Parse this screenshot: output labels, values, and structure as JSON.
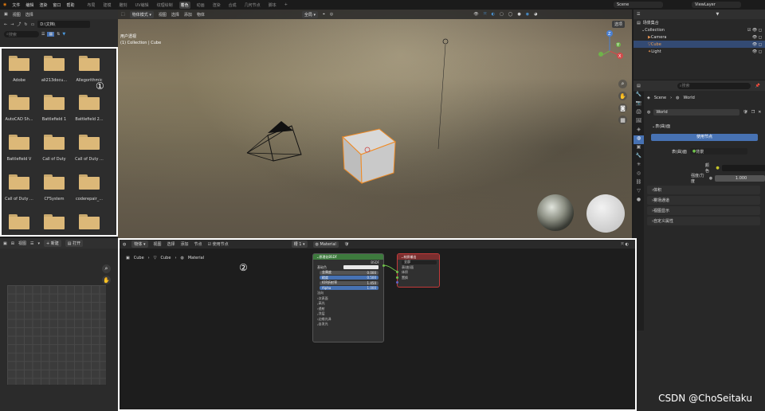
{
  "menu": {
    "items": [
      "文件",
      "编辑",
      "渲染",
      "窗口",
      "帮助"
    ]
  },
  "workspace_tabs": [
    "布局",
    "建模",
    "雕刻",
    "UV编辑",
    "纹理绘制",
    "着色",
    "动画",
    "渲染",
    "合成",
    "几何节点",
    "脚本"
  ],
  "active_tab": "着色",
  "scene": {
    "label": "Scene",
    "view_layer": "ViewLayer"
  },
  "file_browser": {
    "menu": [
      "视图",
      "选择"
    ],
    "path": "D:\\文档\\",
    "search_placeholder": "搜索",
    "folders": [
      "Adobe",
      "ali213docu...",
      "Allegorithmic",
      "AutoCAD Sh...",
      "Battlefield 1",
      "Battlefield 2...",
      "Battlefield V",
      "Call of Duty",
      "Call of Duty ...",
      "Call of Duty ...",
      "CFSystem",
      "coderepair_...",
      "",
      "",
      ""
    ],
    "marker": "①"
  },
  "viewport": {
    "mode": "物体模式",
    "menu": [
      "视图",
      "选择",
      "添加",
      "物体"
    ],
    "transform": "全局",
    "options": "选项",
    "info_line1": "用户透视",
    "info_line2": "(1) Collection | Cube",
    "axis": {
      "z": "Z",
      "y": "Y",
      "x": "X"
    }
  },
  "outliner": {
    "title": "场景集合",
    "rows": [
      {
        "label": "Collection",
        "indent": 1
      },
      {
        "label": "Camera",
        "indent": 2
      },
      {
        "label": "Cube",
        "indent": 2,
        "selected": true
      },
      {
        "label": "Light",
        "indent": 2
      }
    ]
  },
  "properties": {
    "search_placeholder": "搜索",
    "breadcrumb_scene": "Scene",
    "breadcrumb_world": "World",
    "world_name": "World",
    "surface_panel": "表(曲)面",
    "use_nodes": "使用节点",
    "surface_label": "表(曲)面",
    "surface_value": "背景",
    "color_label": "颜色",
    "strength_label": "强度/力度",
    "strength_value": "1.000",
    "sections": [
      "体积",
      "雾场通道",
      "视图显示",
      "自定义属性"
    ]
  },
  "uv_editor": {
    "menu": [
      "视图"
    ],
    "new_label": "新建",
    "open_label": "打开"
  },
  "node_editor": {
    "menu": [
      "物体",
      "视图",
      "选择",
      "添加",
      "节点"
    ],
    "use_nodes": "使用节点",
    "slot": "槽 1",
    "material": "Material",
    "breadcrumb": [
      "Cube",
      "Cube",
      "Material"
    ],
    "marker": "②",
    "bsdf_node": {
      "title": "原理化BSDF",
      "output": "BSDF",
      "rows": [
        "基础色",
        "金属度",
        "糙度",
        "IOR折射率",
        "Alpha"
      ],
      "values": [
        "",
        "0.000",
        "0.500",
        "1.450",
        "1.000"
      ],
      "subsections": [
        "法向",
        "次表面",
        "高光",
        "透射",
        "涂层",
        "边缘光泽",
        "自发光"
      ]
    },
    "output_node": {
      "title": "材质输出",
      "target": "全部",
      "rows": [
        "表(曲)面",
        "体积",
        "置换"
      ]
    }
  },
  "watermark": "CSDN @ChoSeitaku"
}
